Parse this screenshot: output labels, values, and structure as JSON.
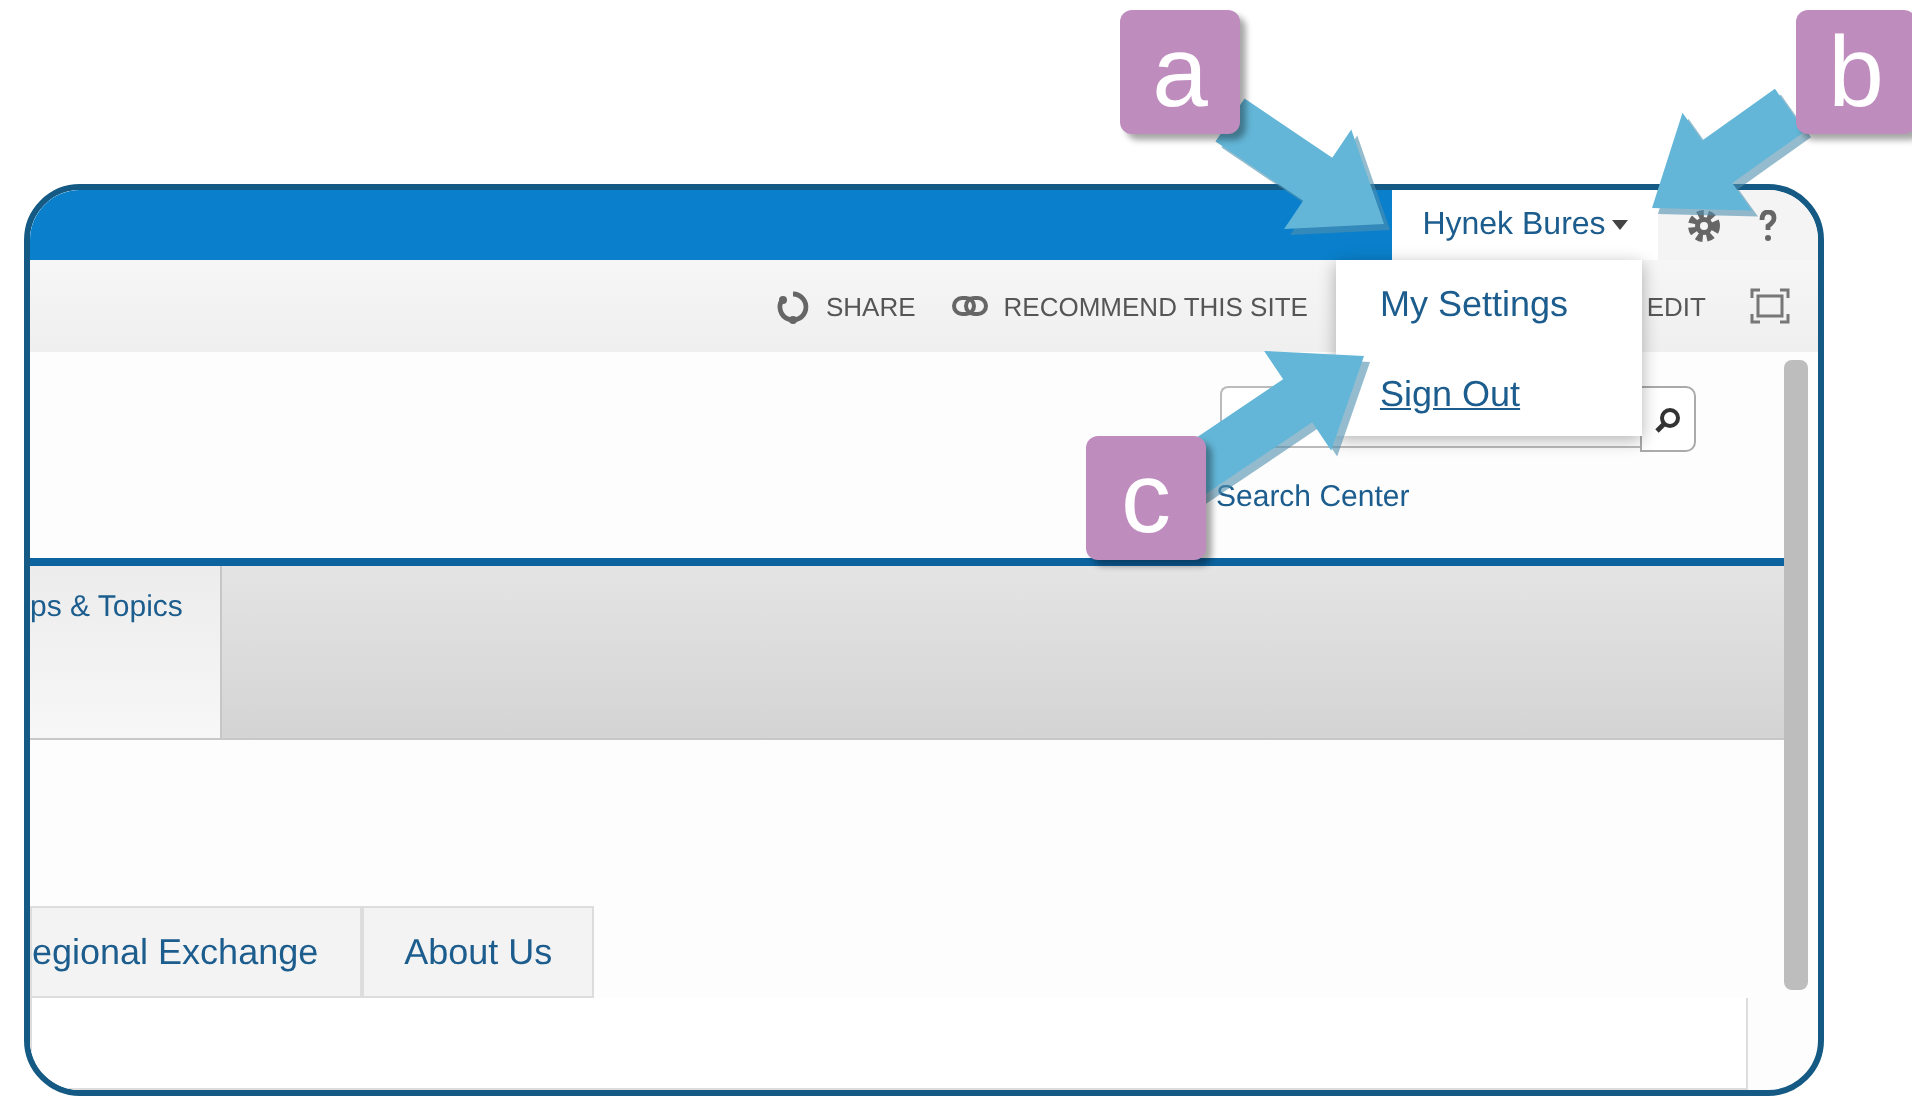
{
  "top_bar": {
    "user_name": "Hynek Bures",
    "user_menu_expanded": true
  },
  "user_menu": {
    "items": [
      {
        "label": "My Settings",
        "hovered": false
      },
      {
        "label": "Sign Out",
        "hovered": true
      }
    ]
  },
  "ribbon": {
    "actions": [
      {
        "kind": "share",
        "label": "SHARE"
      },
      {
        "kind": "recommend",
        "label": "RECOMMEND THIS SITE"
      },
      {
        "kind": "edit",
        "label": "EDIT"
      }
    ]
  },
  "search": {
    "link": "Search Center"
  },
  "nav": {
    "tabs": [
      {
        "label": "ps & Topics",
        "selected": true
      }
    ]
  },
  "content_tabs": [
    {
      "label": "egional Exchange",
      "selected": false
    },
    {
      "label": "About Us",
      "selected": false
    }
  ],
  "annotations": [
    {
      "letter": "a"
    },
    {
      "letter": "b"
    },
    {
      "letter": "c"
    }
  ]
}
